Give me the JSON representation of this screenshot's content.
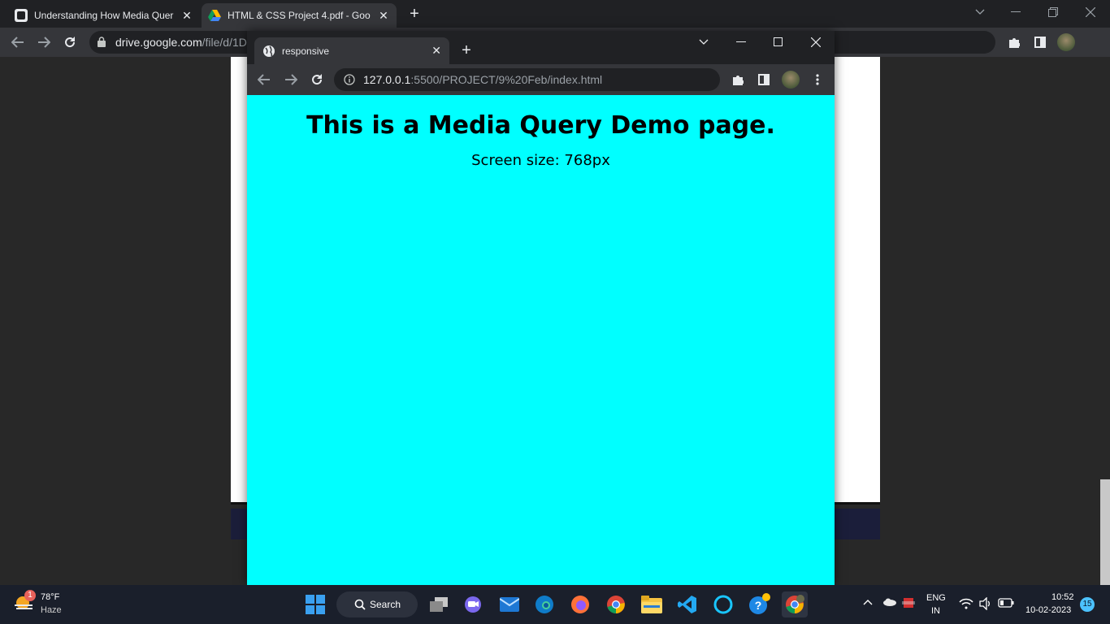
{
  "back_browser": {
    "tabs": [
      {
        "title": "Understanding How Media Quer",
        "close": "✕"
      },
      {
        "title": "HTML & CSS Project 4.pdf - Goo",
        "close": "✕"
      }
    ],
    "new_tab": "+",
    "url_host": "drive.google.com",
    "url_path": "/file/d/1D"
  },
  "front_browser": {
    "tab_title": "responsive",
    "tab_close": "✕",
    "new_tab": "+",
    "url_host": "127.0.0.1",
    "url_path": ":5500/PROJECT/9%20Feb/index.html"
  },
  "page": {
    "heading": "This is a Media Query Demo page.",
    "screen_size_text": "Screen size: 768px"
  },
  "taskbar": {
    "weather_badge": "1",
    "temperature": "78°F",
    "weather_desc": "Haze",
    "search_label": "Search",
    "language_top": "ENG",
    "language_bottom": "IN",
    "time": "10:52",
    "date": "10-02-2023",
    "notification_count": "15"
  },
  "colors": {
    "page_bg": "#00ffff",
    "chrome_dark": "#202124",
    "chrome_toolbar": "#35363a",
    "taskbar_bg": "#1a1f2b"
  }
}
